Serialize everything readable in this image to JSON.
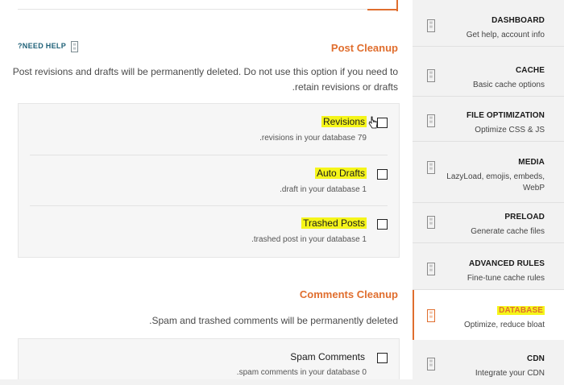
{
  "header": {
    "need_help_label": "?NEED HELP",
    "help_icon": "book-icon"
  },
  "post_cleanup": {
    "title": "Post Cleanup",
    "description_line1": "Post revisions and drafts will be permanently deleted. Do not use this option if you need to",
    "description_line2": ".retain revisions or drafts",
    "options": [
      {
        "label": "Revisions",
        "detail": ".revisions in your database 79",
        "checked": false,
        "highlighted": true
      },
      {
        "label": "Auto Drafts",
        "detail": ".draft in your database 1",
        "checked": false,
        "highlighted": true
      },
      {
        "label": "Trashed Posts",
        "detail": ".trashed post in your database 1",
        "checked": false,
        "highlighted": true
      }
    ]
  },
  "comments_cleanup": {
    "title": "Comments Cleanup",
    "description": ".Spam and trashed comments will be permanently deleted",
    "options": [
      {
        "label": "Spam Comments",
        "detail": ".spam comments in your database 0",
        "checked": false
      }
    ]
  },
  "sidebar": {
    "items": [
      {
        "title": "DASHBOARD",
        "subtitle": "Get help, account info",
        "active": false
      },
      {
        "title": "CACHE",
        "subtitle": "Basic cache options",
        "active": false
      },
      {
        "title": "FILE OPTIMIZATION",
        "subtitle": "Optimize CSS & JS",
        "active": false
      },
      {
        "title": "MEDIA",
        "subtitle_line1": "LazyLoad, emojis, embeds,",
        "subtitle_line2": "WebP",
        "active": false
      },
      {
        "title": "PRELOAD",
        "subtitle": "Generate cache files",
        "active": false
      },
      {
        "title": "ADVANCED RULES",
        "subtitle": "Fine-tune cache rules",
        "active": false
      },
      {
        "title": "DATABASE",
        "subtitle": "Optimize, reduce bloat",
        "active": true
      },
      {
        "title": "CDN",
        "subtitle": "Integrate your CDN",
        "active": false
      }
    ]
  },
  "colors": {
    "accent": "#e06e2e",
    "highlight": "#f5f51a",
    "help_link": "#1f6178"
  }
}
